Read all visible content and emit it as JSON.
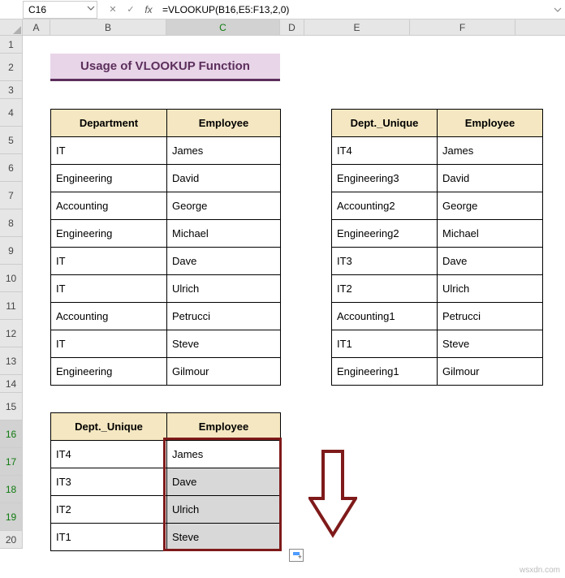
{
  "name_box": "C16",
  "formula": "=VLOOKUP(B16,E5:F13,2,0)",
  "title": "Usage of VLOOKUP Function",
  "columns": [
    "A",
    "B",
    "C",
    "D",
    "E",
    "F"
  ],
  "rows": [
    "1",
    "2",
    "3",
    "4",
    "5",
    "6",
    "7",
    "8",
    "9",
    "10",
    "11",
    "12",
    "13",
    "14",
    "15",
    "16",
    "17",
    "18",
    "19",
    "20"
  ],
  "table1": {
    "headers": [
      "Department",
      "Employee"
    ],
    "data": [
      [
        "IT",
        "James"
      ],
      [
        "Engineering",
        "David"
      ],
      [
        "Accounting",
        "George"
      ],
      [
        "Engineering",
        "Michael"
      ],
      [
        "IT",
        "Dave"
      ],
      [
        "IT",
        "Ulrich"
      ],
      [
        "Accounting",
        "Petrucci"
      ],
      [
        "IT",
        "Steve"
      ],
      [
        "Engineering",
        "Gilmour"
      ]
    ]
  },
  "table2": {
    "headers": [
      "Dept._Unique",
      "Employee"
    ],
    "data": [
      [
        "IT4",
        "James"
      ],
      [
        "Engineering3",
        "David"
      ],
      [
        "Accounting2",
        "George"
      ],
      [
        "Engineering2",
        "Michael"
      ],
      [
        "IT3",
        "Dave"
      ],
      [
        "IT2",
        "Ulrich"
      ],
      [
        "Accounting1",
        "Petrucci"
      ],
      [
        "IT1",
        "Steve"
      ],
      [
        "Engineering1",
        "Gilmour"
      ]
    ]
  },
  "table3": {
    "headers": [
      "Dept._Unique",
      "Employee"
    ],
    "data": [
      [
        "IT4",
        "James"
      ],
      [
        "IT3",
        "Dave"
      ],
      [
        "IT2",
        "Ulrich"
      ],
      [
        "IT1",
        "Steve"
      ]
    ]
  },
  "selection": {
    "active_cell": "C16",
    "range": "C16:C19"
  },
  "colors": {
    "title_bg": "#e8d5e8",
    "title_border": "#5c2f5c",
    "header_bg": "#f4e7c1",
    "sel_border": "#7f1a1a"
  },
  "watermark": "wsxdn.com"
}
